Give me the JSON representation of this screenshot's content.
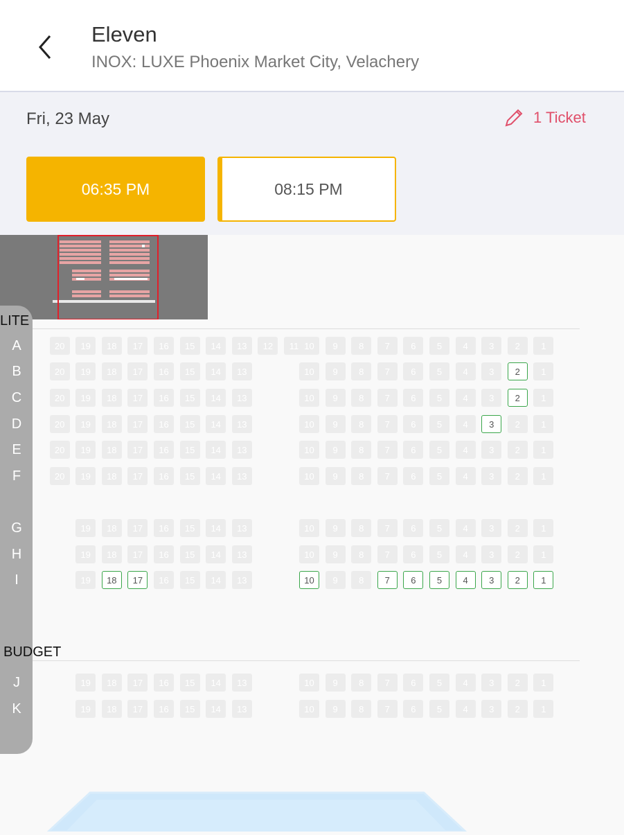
{
  "header": {
    "title": "Eleven",
    "subtitle": "INOX: LUXE Phoenix Market City, Velachery"
  },
  "date": "Fri, 23 May",
  "ticket": {
    "label": "1 Ticket"
  },
  "showtimes": [
    {
      "time": "06:35 PM",
      "selected": true
    },
    {
      "time": "08:15 PM",
      "selected": false
    }
  ],
  "colors": {
    "accent": "#f5b400",
    "available_border": "#3aa64a",
    "edit": "#e04f6a",
    "unavailable": "#ececec"
  },
  "sections": [
    {
      "name": "LITE",
      "rows": [
        {
          "letter": "A",
          "seats": [
            20,
            19,
            18,
            17,
            16,
            15,
            14,
            13,
            12,
            11,
            10,
            9,
            8,
            7,
            6,
            5,
            4,
            3,
            2,
            1
          ],
          "available": []
        },
        {
          "letter": "B",
          "seats": [
            20,
            19,
            18,
            17,
            16,
            15,
            14,
            13,
            10,
            9,
            8,
            7,
            6,
            5,
            4,
            3,
            2,
            1
          ],
          "available": [
            2
          ]
        },
        {
          "letter": "C",
          "seats": [
            20,
            19,
            18,
            17,
            16,
            15,
            14,
            13,
            10,
            9,
            8,
            7,
            6,
            5,
            4,
            3,
            2,
            1
          ],
          "available": [
            2
          ]
        },
        {
          "letter": "D",
          "seats": [
            20,
            19,
            18,
            17,
            16,
            15,
            14,
            13,
            10,
            9,
            8,
            7,
            6,
            5,
            4,
            3,
            2,
            1
          ],
          "available": [
            3
          ]
        },
        {
          "letter": "E",
          "seats": [
            20,
            19,
            18,
            17,
            16,
            15,
            14,
            13,
            10,
            9,
            8,
            7,
            6,
            5,
            4,
            3,
            2,
            1
          ],
          "available": []
        },
        {
          "letter": "F",
          "seats": [
            20,
            19,
            18,
            17,
            16,
            15,
            14,
            13,
            10,
            9,
            8,
            7,
            6,
            5,
            4,
            3,
            2,
            1
          ],
          "available": []
        },
        {
          "letter": "G",
          "seats": [
            19,
            18,
            17,
            16,
            15,
            14,
            13,
            10,
            9,
            8,
            7,
            6,
            5,
            4,
            3,
            2,
            1
          ],
          "available": []
        },
        {
          "letter": "H",
          "seats": [
            19,
            18,
            17,
            16,
            15,
            14,
            13,
            10,
            9,
            8,
            7,
            6,
            5,
            4,
            3,
            2,
            1
          ],
          "available": []
        },
        {
          "letter": "I",
          "seats": [
            19,
            18,
            17,
            16,
            15,
            14,
            13,
            10,
            9,
            8,
            7,
            6,
            5,
            4,
            3,
            2,
            1
          ],
          "available": [
            18,
            17,
            10,
            7,
            6,
            5,
            4,
            3,
            2,
            1
          ]
        }
      ]
    },
    {
      "name": "BUDGET",
      "rows": [
        {
          "letter": "J",
          "seats": [
            19,
            18,
            17,
            16,
            15,
            14,
            13,
            10,
            9,
            8,
            7,
            6,
            5,
            4,
            3,
            2,
            1
          ],
          "available": []
        },
        {
          "letter": "K",
          "seats": [
            19,
            18,
            17,
            16,
            15,
            14,
            13,
            10,
            9,
            8,
            7,
            6,
            5,
            4,
            3,
            2,
            1
          ],
          "available": []
        }
      ]
    }
  ]
}
